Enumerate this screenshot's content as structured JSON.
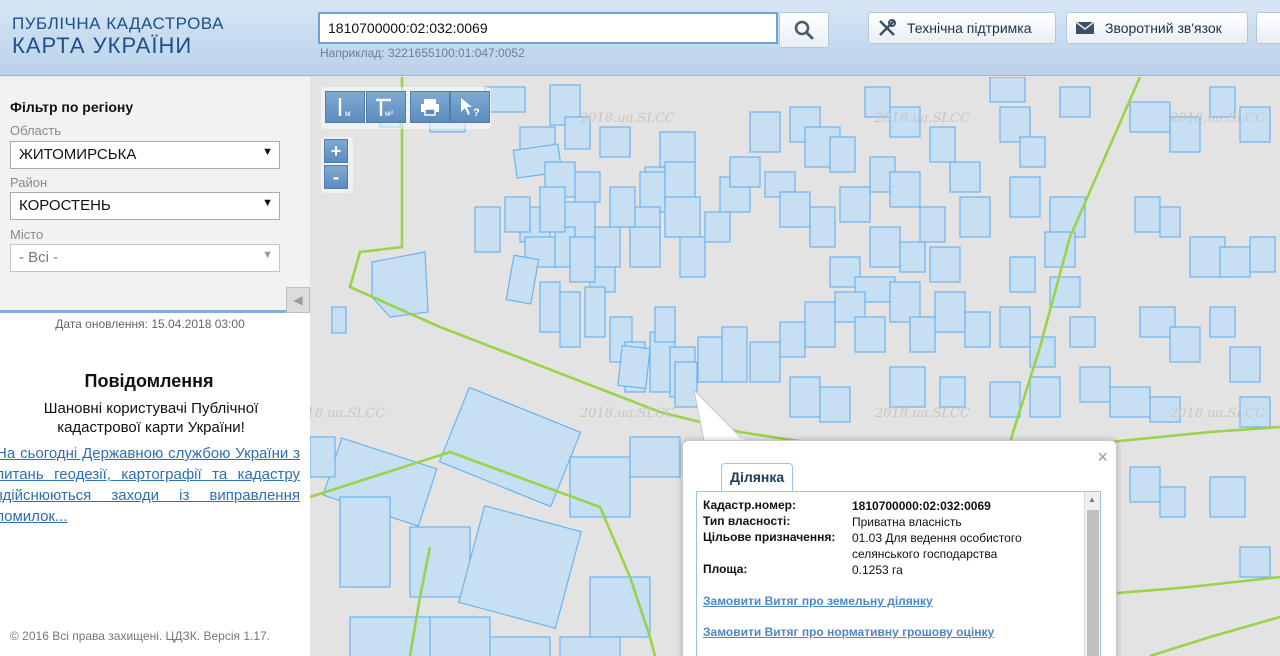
{
  "header": {
    "logo_line1": "ПУБЛІЧНА КАДАСТРОВА",
    "logo_line2": "КАРТА УКРАЇНИ",
    "search_value": "1810700000:02:032:0069",
    "search_example": "Наприклад: 3221655100:01:047:0052",
    "support_label": "Технічна підтримка",
    "feedback_label": "Зворотний зв'язок",
    "search_icon": "search-icon",
    "support_icon": "tools-icon",
    "feedback_icon": "envelope-icon"
  },
  "filter": {
    "title": "Фільтр по регіону",
    "oblast_label": "Область",
    "oblast_value": "ЖИТОМИРСЬКА",
    "raion_label": "Район",
    "raion_value": "КОРОСТЕНЬ",
    "city_label": "Місто",
    "city_value": "- Всі -"
  },
  "sidebar": {
    "update_date": "Дата оновлення: 15.04.2018 03:00",
    "notice_title": "Повідомлення",
    "notice_text": "Шановні користувачі Публічної кадастрової карти України!",
    "notice_link": "На сьогодні Державною службою України з питань геодезії, картографії та кадастру здійснюються заходи із виправлення помилок...",
    "copyright": "© 2016 Всі права захищені. ЦДЗК. Версія 1.17."
  },
  "map": {
    "watermark": "2018.ua.SLCC",
    "zoom_in": "+",
    "zoom_out": "-",
    "tools": [
      "ruler-m-icon",
      "ruler-area-icon",
      "print-icon",
      "identify-icon"
    ],
    "colors": {
      "parcel_stroke": "#6db3ee",
      "parcel_fill": "#c7dff2",
      "boundary": "#9ad34a"
    }
  },
  "popup": {
    "tab": "Ділянка",
    "fields": [
      {
        "key": "Кадастр.номер:",
        "value": "1810700000:02:032:0069",
        "bold": true
      },
      {
        "key": "Тип власності:",
        "value": "Приватна власність"
      },
      {
        "key": "Цільове призначення:",
        "value": "01.03 Для ведення особистого селянського господарства"
      },
      {
        "key": "Площа:",
        "value": "0.1253 га"
      }
    ],
    "link1": "Замовити Витяг про земельну ділянку",
    "link2": "Замовити Витяг про нормативну грошову оцінку",
    "close": "×"
  }
}
